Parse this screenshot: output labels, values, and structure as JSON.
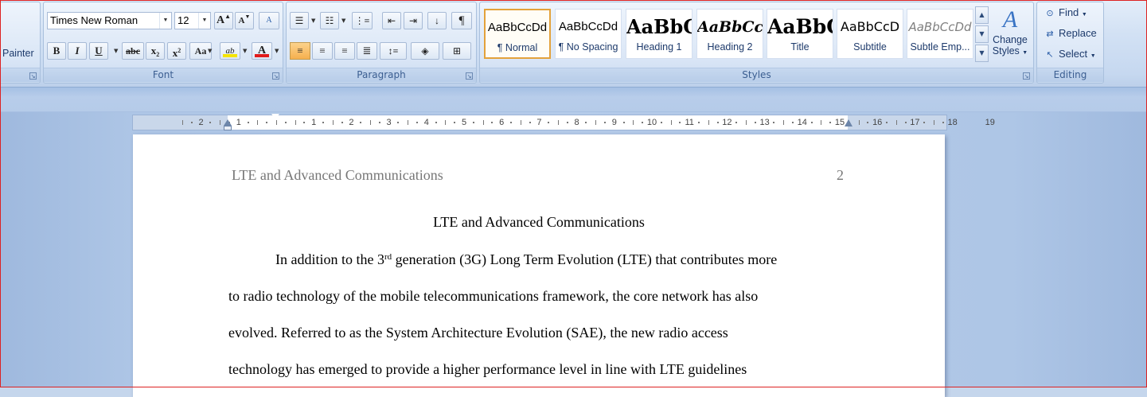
{
  "clipboard": {
    "painter_label": "Painter"
  },
  "font_group": {
    "label": "Font",
    "font_name": "Times New Roman",
    "font_size": "12",
    "grow_icon_text": "A",
    "shrink_icon_text": "A",
    "clear_icon_text": "A",
    "bold": "B",
    "italic": "I",
    "underline": "U",
    "strike": "abc",
    "subscript": "x",
    "subscript_mark": "2",
    "superscript": "x",
    "superscript_mark": "2",
    "change_case": "Aa",
    "highlight_icon_text": "ab",
    "font_color_icon_text": "A"
  },
  "paragraph_group": {
    "label": "Paragraph",
    "pilcrow": "¶"
  },
  "styles_group": {
    "label": "Styles",
    "tiles": [
      {
        "sample": "AaBbCcDd",
        "name": "¶ Normal"
      },
      {
        "sample": "AaBbCcDd",
        "name": "¶ No Spacing"
      },
      {
        "sample": "AaBbC",
        "name": "Heading 1"
      },
      {
        "sample": "AaBbCc",
        "name": "Heading 2"
      },
      {
        "sample": "AaBbC",
        "name": "Title"
      },
      {
        "sample": "AaBbCcD",
        "name": "Subtitle"
      },
      {
        "sample": "AaBbCcDd",
        "name": "Subtle Emp..."
      }
    ],
    "change_styles": "Change",
    "change_styles_2": "Styles"
  },
  "editing_group": {
    "label": "Editing",
    "find": "Find",
    "replace": "Replace",
    "select": "Select"
  },
  "ruler": {
    "left_labels": [
      "2",
      "1"
    ],
    "right_labels": [
      "1",
      "2",
      "3",
      "4",
      "5",
      "6",
      "7",
      "8",
      "9",
      "10",
      "11",
      "12",
      "13",
      "14",
      "15",
      "16",
      "17",
      "18",
      "19"
    ]
  },
  "document": {
    "header_title": "LTE and Advanced Communications",
    "page_number": "2",
    "title": "LTE and Advanced Communications",
    "lines": [
      {
        "pre": "In addition to the 3",
        "sup": "rd",
        "post": " generation (3G) Long Term Evolution (LTE) that contributes more"
      },
      {
        "pre": "to radio technology of the mobile telecommunications framework, the core network has also",
        "sup": "",
        "post": ""
      },
      {
        "pre": "evolved. Referred to as the System Architecture Evolution (SAE), the new radio access",
        "sup": "",
        "post": ""
      },
      {
        "pre": "technology has emerged to provide a higher performance level in line with LTE guidelines",
        "sup": "",
        "post": ""
      }
    ]
  },
  "colors": {
    "highlight": "#f5e400",
    "font_color": "#e11b1b",
    "accent": "#e3a23b"
  }
}
